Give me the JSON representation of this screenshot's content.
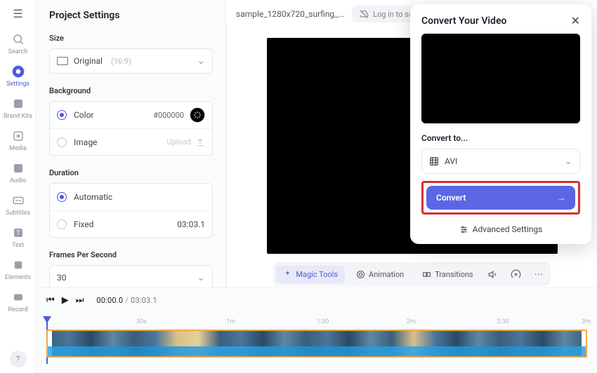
{
  "sidebar": {
    "items": [
      {
        "label": "Search"
      },
      {
        "label": "Settings"
      },
      {
        "label": "Brand Kits"
      },
      {
        "label": "Media"
      },
      {
        "label": "Audio"
      },
      {
        "label": "Subtitles"
      },
      {
        "label": "Text"
      },
      {
        "label": "Elements"
      },
      {
        "label": "Record"
      }
    ],
    "help": "?"
  },
  "panel": {
    "title": "Project Settings",
    "size": {
      "label": "Size",
      "value": "Original",
      "aspect": "(16:9)"
    },
    "background": {
      "label": "Background",
      "color_label": "Color",
      "color_value": "#000000",
      "image_label": "Image",
      "upload_label": "Upload"
    },
    "duration": {
      "label": "Duration",
      "automatic_label": "Automatic",
      "fixed_label": "Fixed",
      "fixed_value": "03:03.1"
    },
    "fps": {
      "label": "Frames Per Second",
      "value": "30"
    }
  },
  "topbar": {
    "filename": "sample_1280x720_surfing_...",
    "login_label": "Log in to sav..."
  },
  "tools": {
    "magic": "Magic Tools",
    "animation": "Animation",
    "transitions": "Transitions"
  },
  "playback": {
    "current": "00:00.0",
    "duration": "03:03.1",
    "ruler": [
      "30s",
      "1m",
      "1:30",
      "2m",
      "2:30",
      "3m"
    ]
  },
  "modal": {
    "title": "Convert Your Video",
    "convert_to": "Convert to...",
    "format": "AVI",
    "button": "Convert",
    "advanced": "Advanced Settings"
  }
}
